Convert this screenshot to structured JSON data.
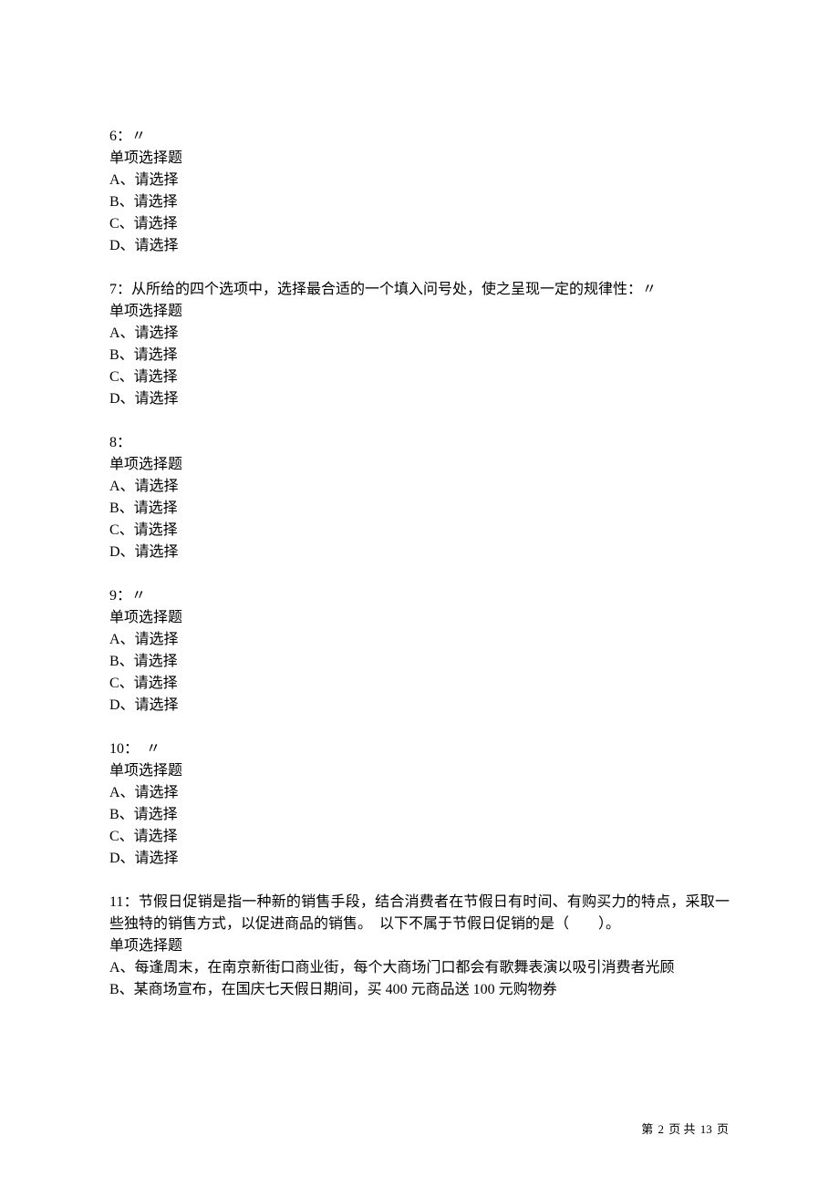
{
  "questions": [
    {
      "number": "6：",
      "stem": "〃",
      "type": "单项选择题",
      "options": [
        "A、请选择",
        "B、请选择",
        "C、请选择",
        "D、请选择"
      ]
    },
    {
      "number": "7：",
      "stem": "从所给的四个选项中，选择最合适的一个填入问号处，使之呈现一定的规律性：〃",
      "type": "单项选择题",
      "options": [
        "A、请选择",
        "B、请选择",
        "C、请选择",
        "D、请选择"
      ]
    },
    {
      "number": "8：",
      "stem": "",
      "type": "单项选择题",
      "options": [
        "A、请选择",
        "B、请选择",
        "C、请选择",
        "D、请选择"
      ]
    },
    {
      "number": "9：",
      "stem": "〃",
      "type": "单项选择题",
      "options": [
        "A、请选择",
        "B、请选择",
        "C、请选择",
        "D、请选择"
      ]
    },
    {
      "number": "10：",
      "stem": "　〃",
      "type": "单项选择题",
      "options": [
        "A、请选择",
        "B、请选择",
        "C、请选择",
        "D、请选择"
      ]
    },
    {
      "number": "11：",
      "stem": "节假日促销是指一种新的销售手段，结合消费者在节假日有时间、有购买力的特点，采取一些独特的销售方式，以促进商品的销售。　以下不属于节假日促销的是（　　）。",
      "type": "单项选择题",
      "options": [
        "A、每逢周末，在南京新街口商业街，每个大商场门口都会有歌舞表演以吸引消费者光顾",
        "B、某商场宣布，在国庆七天假日期间，买 400 元商品送 100 元购物券"
      ]
    }
  ],
  "footer": {
    "prefix": "第",
    "current": "2",
    "mid": "页 共",
    "total": "13",
    "suffix": "页"
  }
}
